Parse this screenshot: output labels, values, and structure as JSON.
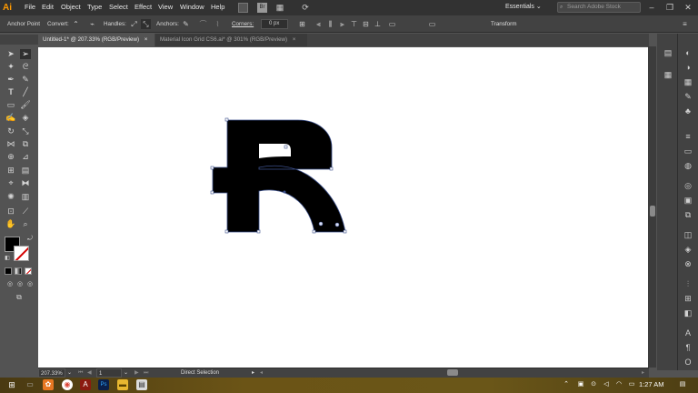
{
  "app": {
    "logo_text": "Ai",
    "accent": "#ff9a00"
  },
  "menu": [
    "File",
    "Edit",
    "Object",
    "Type",
    "Select",
    "Effect",
    "View",
    "Window",
    "Help"
  ],
  "menubar": {
    "workspace": "Essentials",
    "search_placeholder": "Search Adobe Stock",
    "bridge_label": "Br"
  },
  "control_bar": {
    "selection_label": "Anchor Point",
    "convert_label": "Convert:",
    "handles_label": "Handles:",
    "anchors_label": "Anchors:",
    "corners_label": "Corners:",
    "corners_value": "0 px",
    "transform_label": "Transform"
  },
  "tabs": [
    {
      "label": "Untitled-1* @ 207.33% (RGB/Preview)",
      "close": "×",
      "active": true
    },
    {
      "label": "Material Icon Grid CS6.ai* @ 301% (RGB/Preview)",
      "close": "×",
      "active": false
    }
  ],
  "status": {
    "zoom": "207.33%",
    "page": "1",
    "tool": "Direct Selection"
  },
  "taskbar": {
    "clock": "1:27 AM",
    "apps": [
      "start",
      "file-explorer",
      "chrome",
      "acrobat",
      "photoshop",
      "folder",
      "store"
    ]
  },
  "colors": {
    "fill": "#000000",
    "stroke": "#ffffff",
    "none_slash": "#d40000",
    "path_stroke": "#3b4f8a"
  }
}
